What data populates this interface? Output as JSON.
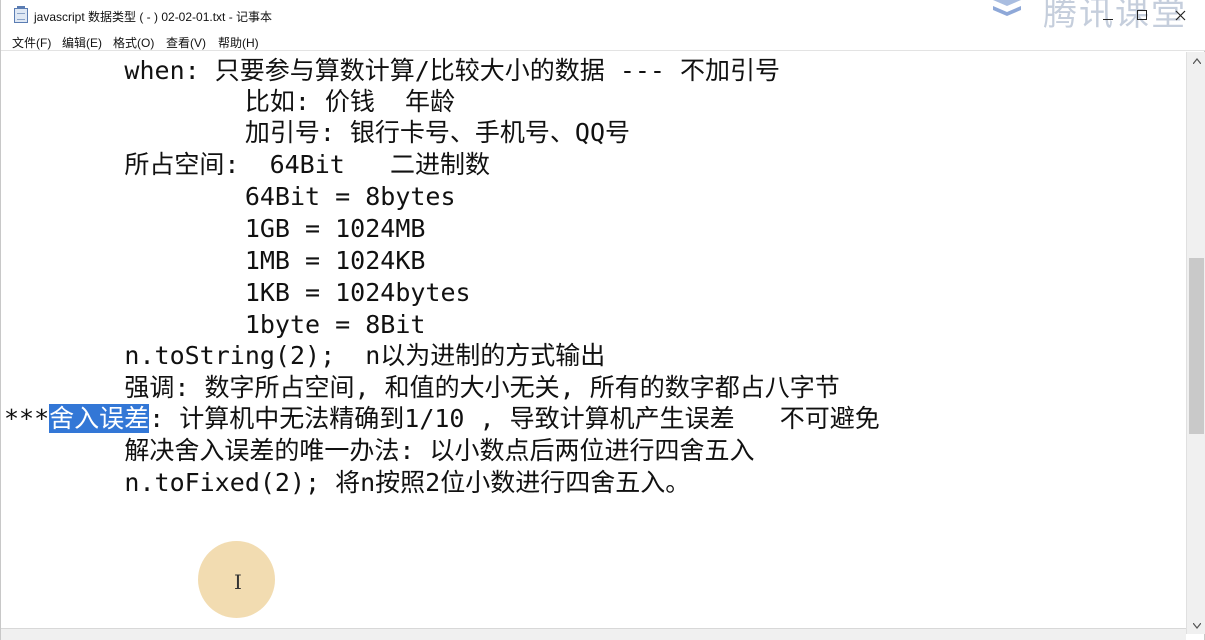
{
  "window": {
    "title": "javascript 数据类型 ( - ) 02-02-01.txt - 记事本",
    "watermark": "腾讯课堂"
  },
  "menu": {
    "items": [
      "文件(F)",
      "编辑(E)",
      "格式(O)",
      "查看(V)",
      "帮助(H)"
    ]
  },
  "editor": {
    "lines": [
      "        when: 只要参与算数计算/比较大小的数据 --- 不加引号",
      "                比如: 价钱  年龄",
      "                加引号: 银行卡号、手机号、QQ号",
      "        所占空间:  64Bit   二进制数",
      "                64Bit = 8bytes",
      "                1GB = 1024MB",
      "                1MB = 1024KB",
      "                1KB = 1024bytes",
      "                1byte = 8Bit",
      "        n.toString(2);  n以为进制的方式输出",
      "        强调: 数字所占空间, 和值的大小无关, 所有的数字都占八字节"
    ],
    "line12": {
      "prefix": "***",
      "selected": "舍入误差",
      "suffix": ": 计算机中无法精确到1/10 , 导致计算机产生误差   不可避免"
    },
    "line13": "        解决舍入误差的唯一办法: 以小数点后两位进行四舍五入",
    "line14": "        n.toFixed(2); 将n按照2位小数进行四舍五入。"
  },
  "cursor": {
    "glyph": "I"
  },
  "colors": {
    "selection": "#3377d6",
    "cursor_highlight": "#f1d8a8",
    "text": "#111111"
  }
}
